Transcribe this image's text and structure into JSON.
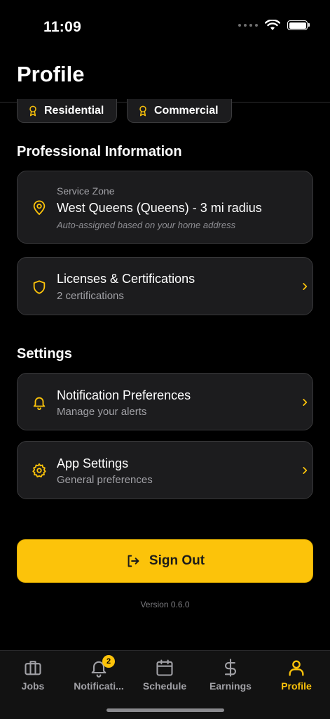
{
  "status": {
    "time": "11:09"
  },
  "header": {
    "title": "Profile"
  },
  "chips": [
    {
      "label": "Residential",
      "icon": "award-icon"
    },
    {
      "label": "Commercial",
      "icon": "award-icon"
    }
  ],
  "professional": {
    "title": "Professional Information",
    "service_zone": {
      "label": "Service Zone",
      "value": "West Queens (Queens) - 3 mi radius",
      "note": "Auto-assigned based on your home address"
    },
    "licenses": {
      "title": "Licenses & Certifications",
      "subtitle": "2 certifications"
    }
  },
  "settings": {
    "title": "Settings",
    "notifications": {
      "title": "Notification Preferences",
      "subtitle": "Manage your alerts"
    },
    "app": {
      "title": "App Settings",
      "subtitle": "General preferences"
    }
  },
  "sign_out": "Sign Out",
  "version": "Version 0.6.0",
  "tabs": [
    {
      "label": "Jobs",
      "icon": "briefcase-icon"
    },
    {
      "label": "Notificati...",
      "icon": "bell-icon",
      "badge": "2"
    },
    {
      "label": "Schedule",
      "icon": "calendar-icon"
    },
    {
      "label": "Earnings",
      "icon": "dollar-icon"
    },
    {
      "label": "Profile",
      "icon": "user-icon",
      "active": true
    }
  ],
  "colors": {
    "accent": "#fcc30a",
    "card": "#1c1c1e",
    "background": "#000000"
  }
}
